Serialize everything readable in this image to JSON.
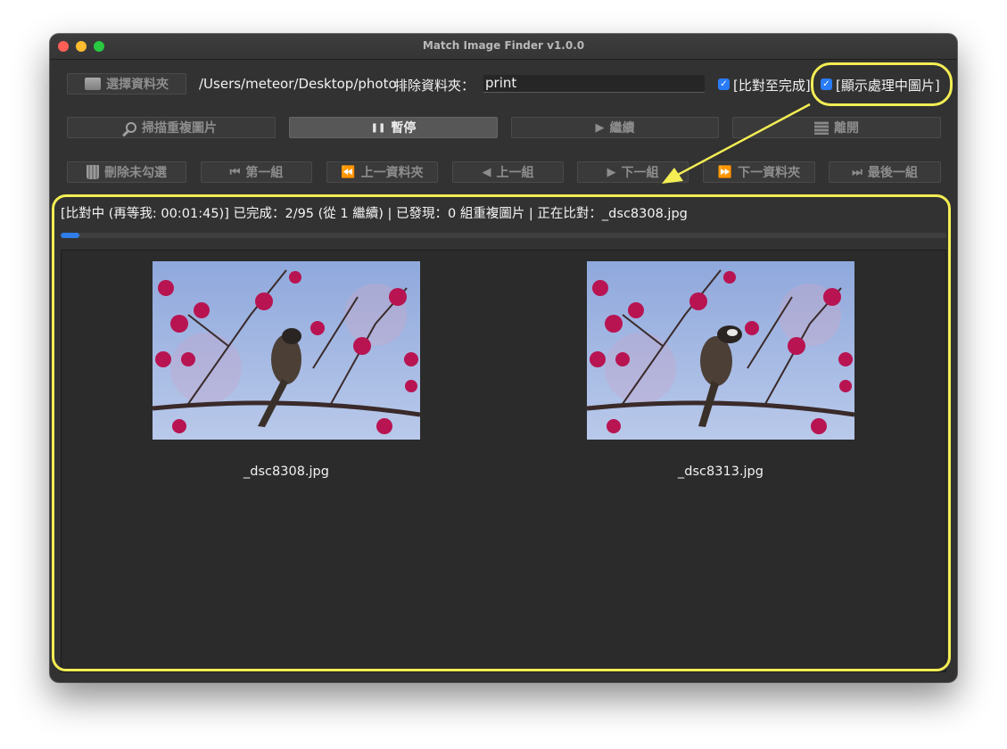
{
  "window": {
    "title": "Match Image Finder v1.0.0"
  },
  "toolbar": {
    "select_folder": "選擇資料夾",
    "path": "/Users/meteor/Desktop/photo",
    "exclude_label": "排除資料夾：",
    "exclude_value": "print",
    "compare_to_end": {
      "label": "[比對至完成]",
      "checked": true
    },
    "show_processing": {
      "label": "[顯示處理中圖片]",
      "checked": true
    },
    "scan": "掃描重複圖片",
    "pause": "暫停",
    "resume": "繼續",
    "exit": "離開",
    "delete_unchecked": "刪除未勾選",
    "first_group": "第一組",
    "prev_folder": "上一資料夾",
    "prev_group": "上一組",
    "next_group": "下一組",
    "next_folder": "下一資料夾",
    "last_group": "最後一組"
  },
  "status": {
    "text": "[比對中 (再等我: 00:01:45)] 已完成：2/95 (從 1 繼續) | 已發現：0 組重複圖片 | 正在比對：_dsc8308.jpg",
    "progress": 0.021
  },
  "images": [
    {
      "filename": "_dsc8308.jpg"
    },
    {
      "filename": "_dsc8313.jpg"
    }
  ],
  "colors": {
    "window_bg": "#323232",
    "highlight": "#f4ee54",
    "accent": "#2a7cf6"
  },
  "icons": [
    "folder-icon",
    "magnifier-icon",
    "pause-icon",
    "play-icon",
    "exit-door-icon",
    "trash-icon",
    "skip-first-icon",
    "rewind-icon",
    "prev-icon",
    "next-icon",
    "fast-forward-icon",
    "skip-last-icon"
  ]
}
